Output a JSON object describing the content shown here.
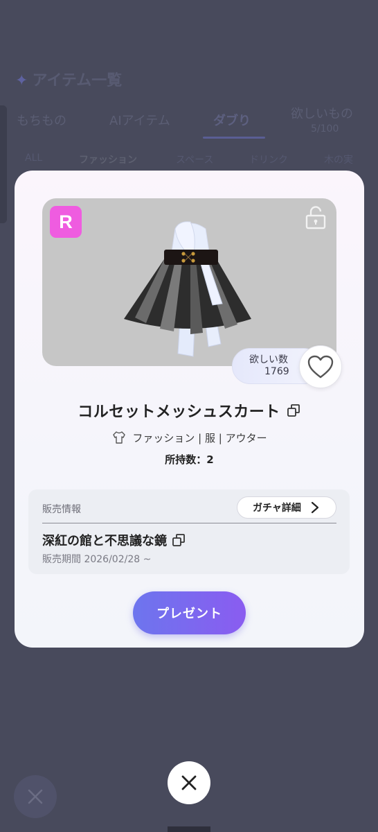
{
  "background": {
    "title": "アイテム一覧",
    "tabs": [
      {
        "label": "もちもの"
      },
      {
        "label": "AIアイテム"
      },
      {
        "label": "ダブり"
      },
      {
        "label": "欲しいもの",
        "count": "5/100"
      }
    ],
    "chips": [
      "ALL",
      "ファッション",
      "スペース",
      "ドリンク",
      "木の実"
    ]
  },
  "item": {
    "rarity": "R",
    "name": "コルセットメッシュスカート",
    "category": "ファッション | 服 | アウター",
    "owned": "所持数：2",
    "wish_label": "欲しい数",
    "wish_count": "1769",
    "colors": {
      "rarity_badge": "#ef5ce0",
      "preview_bg": "#c6c6c6"
    }
  },
  "sales": {
    "label": "販売情報",
    "gacha_button": "ガチャ詳細",
    "gacha_name": "深紅の館と不思議な鏡",
    "period": "販売期間 2026/02/28 ~"
  },
  "actions": {
    "present": "プレゼント"
  },
  "icons": [
    "lock-icon",
    "heart-icon",
    "copy-icon",
    "shirt-icon",
    "chevron-right-icon",
    "close-icon"
  ]
}
